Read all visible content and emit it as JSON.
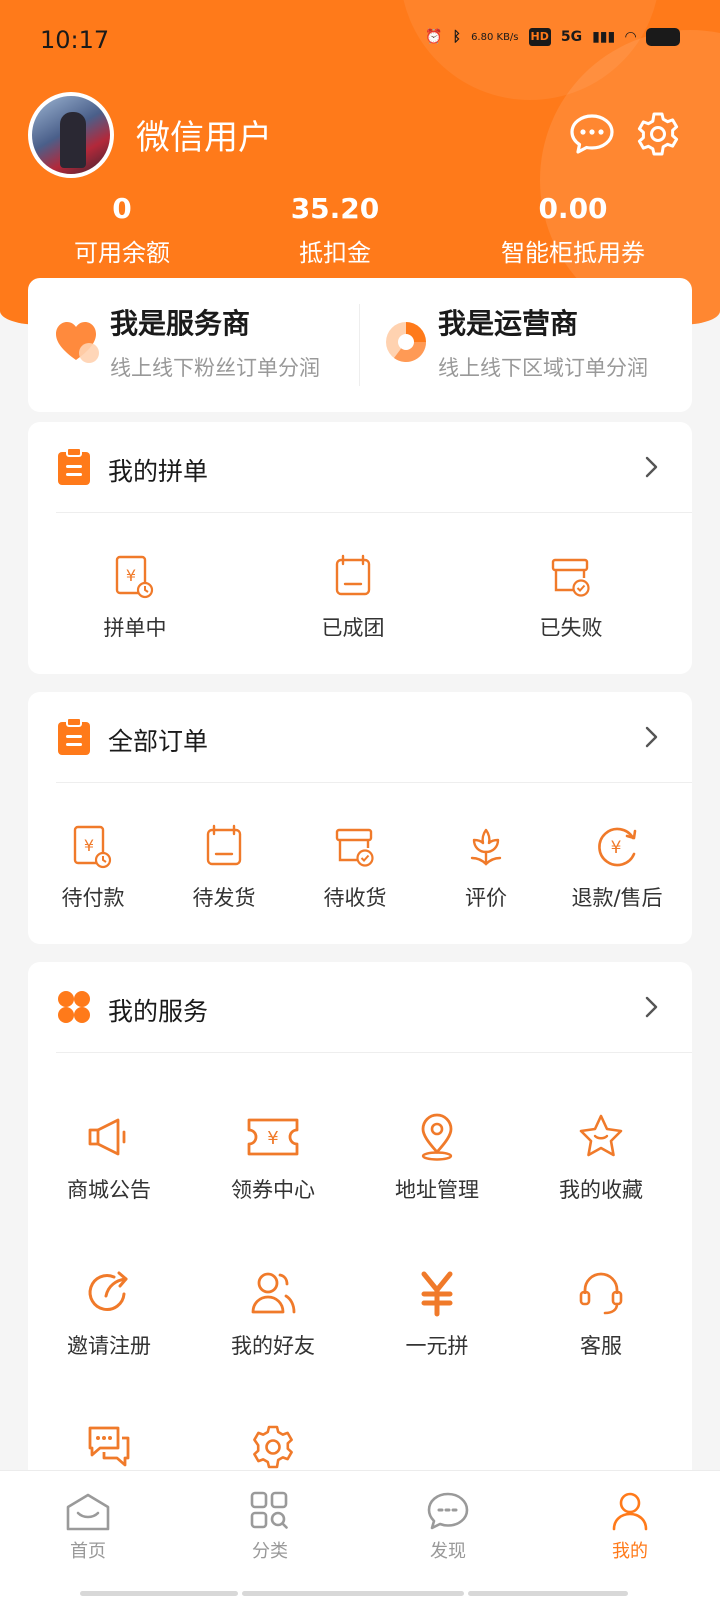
{
  "status_bar": {
    "time": "10:17",
    "net_speed": "6.80 KB/s",
    "hd": "HD",
    "signal": "5G"
  },
  "header": {
    "username": "微信用户",
    "stats": [
      {
        "value": "0",
        "label": "可用余额"
      },
      {
        "value": "35.20",
        "label": "抵扣金"
      },
      {
        "value": "0.00",
        "label": "智能柜抵用券"
      }
    ]
  },
  "roles": [
    {
      "title": "我是服务商",
      "subtitle": "线上线下粉丝订单分润"
    },
    {
      "title": "我是运营商",
      "subtitle": "线上线下区域订单分润"
    }
  ],
  "group_orders": {
    "title": "我的拼单",
    "items": [
      {
        "label": "拼单中",
        "icon": "yuan-clock-icon"
      },
      {
        "label": "已成团",
        "icon": "bag-icon"
      },
      {
        "label": "已失败",
        "icon": "box-check-icon"
      }
    ]
  },
  "all_orders": {
    "title": "全部订单",
    "items": [
      {
        "label": "待付款",
        "icon": "yuan-clock-icon"
      },
      {
        "label": "待发货",
        "icon": "bag-icon"
      },
      {
        "label": "待收货",
        "icon": "box-check-icon"
      },
      {
        "label": "评价",
        "icon": "flower-icon"
      },
      {
        "label": "退款/售后",
        "icon": "refund-icon"
      }
    ]
  },
  "services": {
    "title": "我的服务",
    "items": [
      {
        "label": "商城公告",
        "icon": "megaphone-icon"
      },
      {
        "label": "领券中心",
        "icon": "coupon-icon"
      },
      {
        "label": "地址管理",
        "icon": "location-icon"
      },
      {
        "label": "我的收藏",
        "icon": "star-icon"
      },
      {
        "label": "邀请注册",
        "icon": "share-icon"
      },
      {
        "label": "我的好友",
        "icon": "friends-icon"
      },
      {
        "label": "一元拼",
        "icon": "yuan-icon"
      },
      {
        "label": "客服",
        "icon": "headset-icon"
      },
      {
        "label": "",
        "icon": "chat-icon"
      },
      {
        "label": "",
        "icon": "gear-icon"
      }
    ]
  },
  "tabbar": {
    "tabs": [
      {
        "label": "首页",
        "icon": "home-icon"
      },
      {
        "label": "分类",
        "icon": "category-icon"
      },
      {
        "label": "发现",
        "icon": "discover-icon"
      },
      {
        "label": "我的",
        "icon": "profile-icon",
        "active": true
      }
    ]
  },
  "colors": {
    "accent": "#ff7a1a",
    "background": "#f5f5f5",
    "text": "#333333",
    "muted": "#999999"
  }
}
